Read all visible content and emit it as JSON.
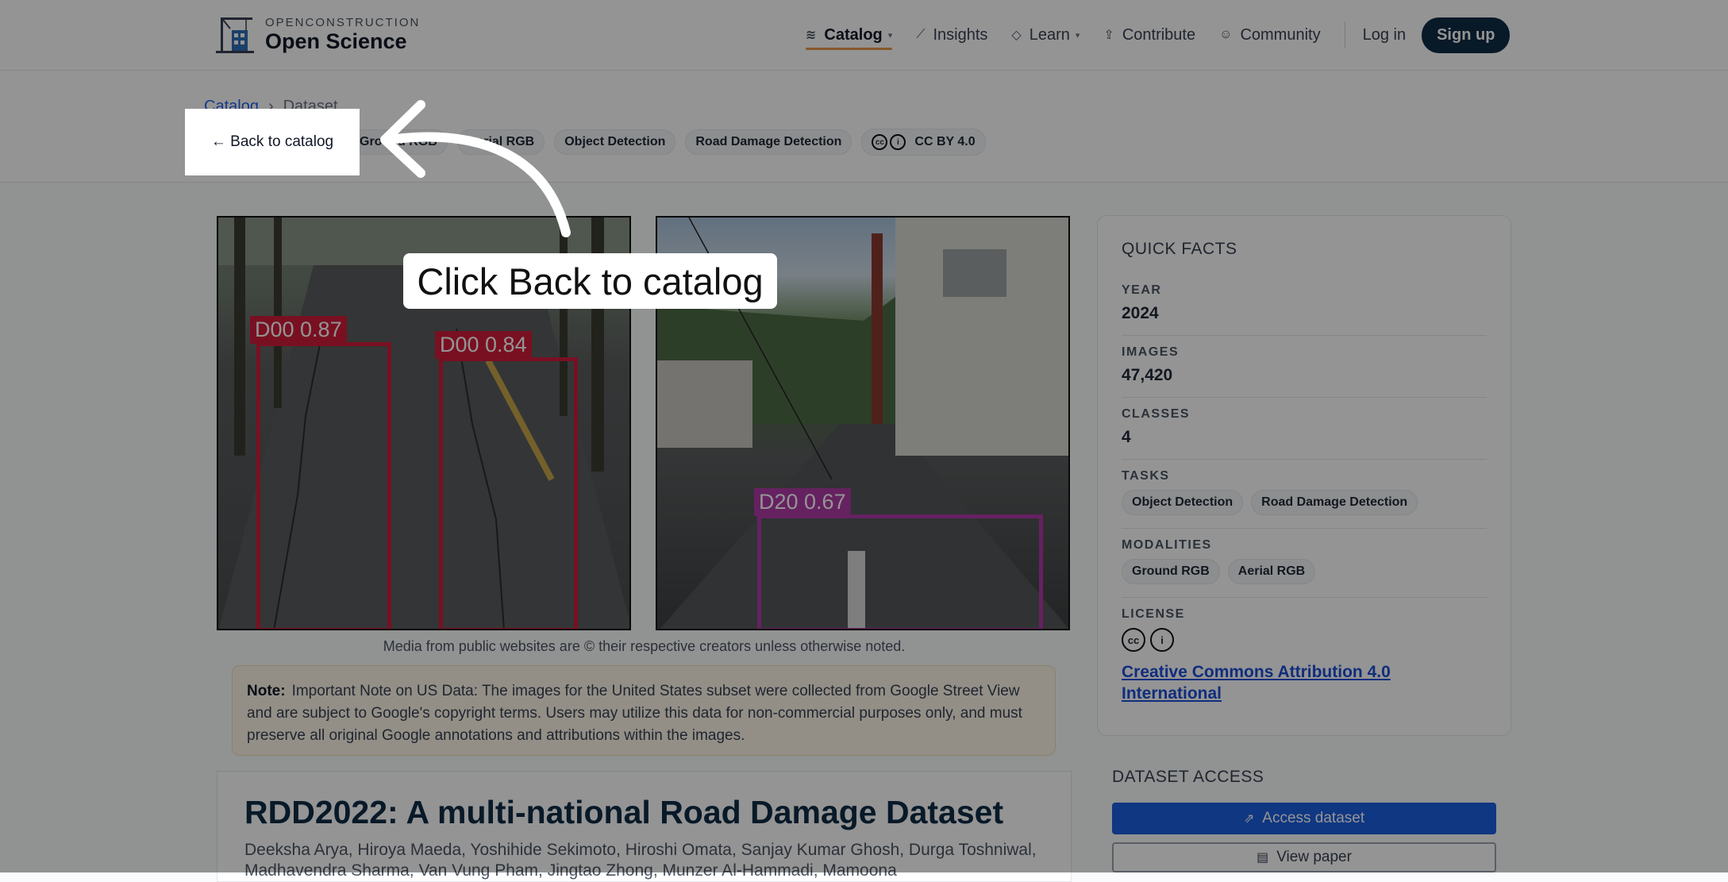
{
  "brand": {
    "small": "OPENCONSTRUCTION",
    "big": "Open Science"
  },
  "nav": {
    "items": [
      {
        "label": "Catalog",
        "icon": "layers-icon",
        "active": true,
        "dropdown": true
      },
      {
        "label": "Insights",
        "icon": "chart-icon",
        "active": false,
        "dropdown": false
      },
      {
        "label": "Learn",
        "icon": "graduation-icon",
        "active": false,
        "dropdown": true
      },
      {
        "label": "Contribute",
        "icon": "upload-icon",
        "active": false,
        "dropdown": false
      },
      {
        "label": "Community",
        "icon": "user-icon",
        "active": false,
        "dropdown": false
      }
    ],
    "login": "Log in",
    "signup": "Sign up"
  },
  "breadcrumb": {
    "root": "Catalog",
    "separator": "›",
    "current": "Dataset"
  },
  "back_label": "← Back to catalog",
  "chips": [
    "Ground RGB",
    "Aerial RGB",
    "Object Detection",
    "Road Damage Detection"
  ],
  "license_chip": "CC BY 4.0",
  "media": {
    "detections_left": [
      {
        "label": "D00 0.87"
      },
      {
        "label": "D00 0.84"
      }
    ],
    "detections_right": [
      {
        "label": "D20 0.67"
      }
    ],
    "caption": "Media from public websites are © their respective creators unless otherwise noted."
  },
  "note": {
    "label": "Note:",
    "text": "Important Note on US Data: The images for the United States subset were collected from Google Street View and are subject to Google's copyright terms. Users may utilize this data for non-commercial purposes only, and must preserve all original Google annotations and attributions within the images."
  },
  "dataset": {
    "title": "RDD2022: A multi-national Road Damage Dataset",
    "authors": "Deeksha Arya, Hiroya Maeda, Yoshihide Sekimoto, Hiroshi Omata, Sanjay Kumar Ghosh, Durga Toshniwal, Madhavendra Sharma, Van Vung Pham, Jingtao Zhong, Munzer Al-Hammadi, Mamoona"
  },
  "quick_facts": {
    "heading": "QUICK FACTS",
    "year_label": "YEAR",
    "year": "2024",
    "images_label": "IMAGES",
    "images": "47,420",
    "classes_label": "CLASSES",
    "classes": "4",
    "tasks_label": "TASKS",
    "tasks": [
      "Object Detection",
      "Road Damage Detection"
    ],
    "modalities_label": "MODALITIES",
    "modalities": [
      "Ground RGB",
      "Aerial RGB"
    ],
    "license_label": "LICENSE",
    "license_link": "Creative Commons Attribution 4.0 International"
  },
  "access": {
    "heading": "DATASET ACCESS",
    "access_btn": "Access dataset",
    "paper_btn": "View paper"
  },
  "annotation": {
    "callout": "Click Back to catalog"
  },
  "colors": {
    "accent": "#e8964a",
    "primary": "#0f2b46",
    "link": "#1d4ed8",
    "bbox_d00": "#d11d3b",
    "bbox_d20": "#b03aa8"
  }
}
